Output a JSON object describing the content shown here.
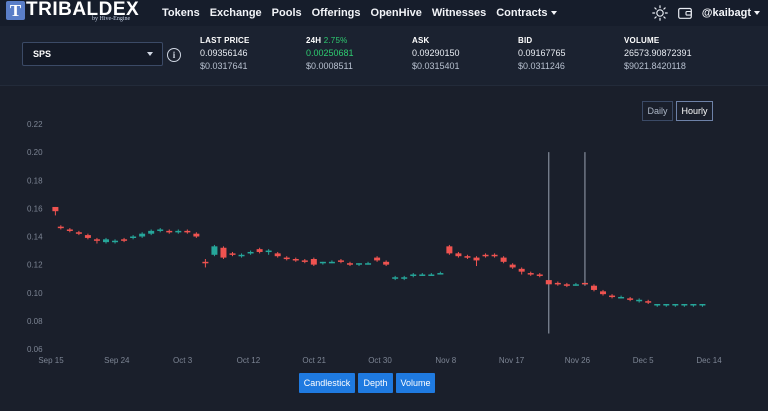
{
  "brand": {
    "name": "TRIBALDEX",
    "badge": "T",
    "sub": "by Hive-Engine"
  },
  "nav": {
    "items": [
      "Tokens",
      "Exchange",
      "Pools",
      "Offerings",
      "OpenHive",
      "Witnesses",
      "Contracts"
    ],
    "user": "@kaibagt"
  },
  "icons": {
    "theme": "sun-icon",
    "wallet": "wallet-icon",
    "info": "info-icon"
  },
  "token_select": {
    "value": "SPS"
  },
  "stats": {
    "last_price": {
      "label": "LAST PRICE",
      "value": "0.09356146",
      "usd": "$0.0317641"
    },
    "change_24h": {
      "label": "24H",
      "pct": "2.75%",
      "value": "0.00250681",
      "usd": "$0.0008511"
    },
    "ask": {
      "label": "ASK",
      "value": "0.09290150",
      "usd": "$0.0315401"
    },
    "bid": {
      "label": "BID",
      "value": "0.09167765",
      "usd": "$0.0311246"
    },
    "volume": {
      "label": "VOLUME",
      "value": "26573.90872391",
      "usd": "$9021.8420118"
    }
  },
  "interval": {
    "daily": "Daily",
    "hourly": "Hourly",
    "selected": "Hourly"
  },
  "chart_tabs": {
    "candlestick": "Candlestick",
    "depth": "Depth",
    "volume": "Volume"
  },
  "colors": {
    "up": "#26a69a",
    "down": "#ef5350",
    "wick": "#9aa3b2",
    "axis_text": "#7d8594",
    "button": "#1f7ae0"
  },
  "chart_data": {
    "type": "candlestick",
    "x_ticks": [
      "Sep 15",
      "Sep 24",
      "Oct 3",
      "Oct 12",
      "Oct 21",
      "Oct 30",
      "Nov 8",
      "Nov 17",
      "Nov 26",
      "Dec 5",
      "Dec 14"
    ],
    "y_ticks": [
      "0.22",
      "0.20",
      "0.18",
      "0.16",
      "0.14",
      "0.12",
      "0.10",
      "0.08",
      "0.06"
    ],
    "ylim": [
      0.06,
      0.22
    ],
    "series": [
      {
        "day": 1.0,
        "o": 0.161,
        "h": 0.161,
        "l": 0.155,
        "c": 0.158
      },
      {
        "day": 1.6,
        "o": 0.147,
        "h": 0.148,
        "l": 0.145,
        "c": 0.146
      },
      {
        "day": 2.6,
        "o": 0.145,
        "h": 0.146,
        "l": 0.143,
        "c": 0.144
      },
      {
        "day": 3.6,
        "o": 0.143,
        "h": 0.144,
        "l": 0.141,
        "c": 0.142
      },
      {
        "day": 4.6,
        "o": 0.141,
        "h": 0.142,
        "l": 0.138,
        "c": 0.139
      },
      {
        "day": 5.6,
        "o": 0.138,
        "h": 0.139,
        "l": 0.135,
        "c": 0.137
      },
      {
        "day": 6.6,
        "o": 0.136,
        "h": 0.139,
        "l": 0.135,
        "c": 0.138
      },
      {
        "day": 7.6,
        "o": 0.136,
        "h": 0.138,
        "l": 0.135,
        "c": 0.137
      },
      {
        "day": 8.6,
        "o": 0.138,
        "h": 0.139,
        "l": 0.136,
        "c": 0.137
      },
      {
        "day": 9.6,
        "o": 0.139,
        "h": 0.141,
        "l": 0.138,
        "c": 0.14
      },
      {
        "day": 10.6,
        "o": 0.14,
        "h": 0.143,
        "l": 0.139,
        "c": 0.142
      },
      {
        "day": 11.6,
        "o": 0.142,
        "h": 0.145,
        "l": 0.141,
        "c": 0.144
      },
      {
        "day": 12.6,
        "o": 0.144,
        "h": 0.146,
        "l": 0.143,
        "c": 0.145
      },
      {
        "day": 13.6,
        "o": 0.144,
        "h": 0.145,
        "l": 0.142,
        "c": 0.143
      },
      {
        "day": 14.6,
        "o": 0.143,
        "h": 0.145,
        "l": 0.142,
        "c": 0.144
      },
      {
        "day": 15.6,
        "o": 0.144,
        "h": 0.145,
        "l": 0.142,
        "c": 0.143
      },
      {
        "day": 16.6,
        "o": 0.142,
        "h": 0.143,
        "l": 0.139,
        "c": 0.14
      },
      {
        "day": 17.6,
        "o": 0.122,
        "h": 0.124,
        "l": 0.118,
        "c": 0.121
      },
      {
        "day": 18.6,
        "o": 0.127,
        "h": 0.134,
        "l": 0.126,
        "c": 0.133
      },
      {
        "day": 19.6,
        "o": 0.132,
        "h": 0.133,
        "l": 0.124,
        "c": 0.125
      },
      {
        "day": 20.6,
        "o": 0.128,
        "h": 0.129,
        "l": 0.126,
        "c": 0.127
      },
      {
        "day": 21.6,
        "o": 0.126,
        "h": 0.128,
        "l": 0.125,
        "c": 0.127
      },
      {
        "day": 22.6,
        "o": 0.128,
        "h": 0.13,
        "l": 0.127,
        "c": 0.129
      },
      {
        "day": 23.6,
        "o": 0.131,
        "h": 0.132,
        "l": 0.128,
        "c": 0.129
      },
      {
        "day": 24.6,
        "o": 0.129,
        "h": 0.131,
        "l": 0.127,
        "c": 0.13
      },
      {
        "day": 25.6,
        "o": 0.128,
        "h": 0.129,
        "l": 0.125,
        "c": 0.126
      },
      {
        "day": 26.6,
        "o": 0.125,
        "h": 0.126,
        "l": 0.123,
        "c": 0.124
      },
      {
        "day": 27.6,
        "o": 0.124,
        "h": 0.125,
        "l": 0.122,
        "c": 0.123
      },
      {
        "day": 28.6,
        "o": 0.123,
        "h": 0.124,
        "l": 0.121,
        "c": 0.122
      },
      {
        "day": 29.6,
        "o": 0.124,
        "h": 0.125,
        "l": 0.119,
        "c": 0.12
      },
      {
        "day": 30.6,
        "o": 0.121,
        "h": 0.122,
        "l": 0.12,
        "c": 0.122
      },
      {
        "day": 31.6,
        "o": 0.122,
        "h": 0.123,
        "l": 0.121,
        "c": 0.122
      },
      {
        "day": 32.6,
        "o": 0.123,
        "h": 0.124,
        "l": 0.121,
        "c": 0.122
      },
      {
        "day": 33.6,
        "o": 0.121,
        "h": 0.122,
        "l": 0.119,
        "c": 0.12
      },
      {
        "day": 34.6,
        "o": 0.12,
        "h": 0.121,
        "l": 0.119,
        "c": 0.121
      },
      {
        "day": 35.6,
        "o": 0.121,
        "h": 0.122,
        "l": 0.12,
        "c": 0.121
      },
      {
        "day": 36.6,
        "o": 0.125,
        "h": 0.126,
        "l": 0.122,
        "c": 0.123
      },
      {
        "day": 37.6,
        "o": 0.122,
        "h": 0.123,
        "l": 0.119,
        "c": 0.12
      },
      {
        "day": 38.6,
        "o": 0.11,
        "h": 0.112,
        "l": 0.109,
        "c": 0.111
      },
      {
        "day": 39.6,
        "o": 0.11,
        "h": 0.112,
        "l": 0.109,
        "c": 0.111
      },
      {
        "day": 40.6,
        "o": 0.112,
        "h": 0.114,
        "l": 0.111,
        "c": 0.113
      },
      {
        "day": 41.6,
        "o": 0.113,
        "h": 0.114,
        "l": 0.112,
        "c": 0.113
      },
      {
        "day": 42.6,
        "o": 0.113,
        "h": 0.114,
        "l": 0.112,
        "c": 0.113
      },
      {
        "day": 43.6,
        "o": 0.114,
        "h": 0.115,
        "l": 0.113,
        "c": 0.114
      },
      {
        "day": 44.6,
        "o": 0.133,
        "h": 0.134,
        "l": 0.127,
        "c": 0.128
      },
      {
        "day": 45.6,
        "o": 0.128,
        "h": 0.129,
        "l": 0.125,
        "c": 0.126
      },
      {
        "day": 46.6,
        "o": 0.126,
        "h": 0.127,
        "l": 0.124,
        "c": 0.125
      },
      {
        "day": 47.6,
        "o": 0.125,
        "h": 0.126,
        "l": 0.119,
        "c": 0.123
      },
      {
        "day": 48.6,
        "o": 0.127,
        "h": 0.128,
        "l": 0.125,
        "c": 0.126
      },
      {
        "day": 49.6,
        "o": 0.127,
        "h": 0.128,
        "l": 0.125,
        "c": 0.126
      },
      {
        "day": 50.6,
        "o": 0.125,
        "h": 0.126,
        "l": 0.121,
        "c": 0.122
      },
      {
        "day": 51.6,
        "o": 0.12,
        "h": 0.121,
        "l": 0.117,
        "c": 0.118
      },
      {
        "day": 52.6,
        "o": 0.117,
        "h": 0.118,
        "l": 0.113,
        "c": 0.115
      },
      {
        "day": 53.6,
        "o": 0.114,
        "h": 0.115,
        "l": 0.112,
        "c": 0.113
      },
      {
        "day": 54.6,
        "o": 0.113,
        "h": 0.114,
        "l": 0.111,
        "c": 0.112
      },
      {
        "day": 55.6,
        "o": 0.109,
        "h": 0.2,
        "l": 0.071,
        "c": 0.106
      },
      {
        "day": 56.6,
        "o": 0.107,
        "h": 0.108,
        "l": 0.105,
        "c": 0.106
      },
      {
        "day": 57.6,
        "o": 0.106,
        "h": 0.107,
        "l": 0.104,
        "c": 0.105
      },
      {
        "day": 58.6,
        "o": 0.106,
        "h": 0.107,
        "l": 0.105,
        "c": 0.106
      },
      {
        "day": 59.6,
        "o": 0.107,
        "h": 0.2,
        "l": 0.105,
        "c": 0.106
      },
      {
        "day": 60.6,
        "o": 0.105,
        "h": 0.106,
        "l": 0.101,
        "c": 0.102
      },
      {
        "day": 61.6,
        "o": 0.101,
        "h": 0.102,
        "l": 0.098,
        "c": 0.099
      },
      {
        "day": 62.6,
        "o": 0.098,
        "h": 0.099,
        "l": 0.096,
        "c": 0.097
      },
      {
        "day": 63.6,
        "o": 0.097,
        "h": 0.098,
        "l": 0.096,
        "c": 0.097
      },
      {
        "day": 64.6,
        "o": 0.096,
        "h": 0.097,
        "l": 0.094,
        "c": 0.095
      },
      {
        "day": 65.6,
        "o": 0.094,
        "h": 0.096,
        "l": 0.093,
        "c": 0.095
      },
      {
        "day": 66.6,
        "o": 0.094,
        "h": 0.095,
        "l": 0.092,
        "c": 0.093
      },
      {
        "day": 67.6,
        "o": 0.091,
        "h": 0.092,
        "l": 0.09,
        "c": 0.092
      },
      {
        "day": 68.6,
        "o": 0.091,
        "h": 0.092,
        "l": 0.09,
        "c": 0.092
      },
      {
        "day": 69.6,
        "o": 0.091,
        "h": 0.092,
        "l": 0.09,
        "c": 0.092
      },
      {
        "day": 70.6,
        "o": 0.091,
        "h": 0.092,
        "l": 0.09,
        "c": 0.092
      },
      {
        "day": 71.6,
        "o": 0.091,
        "h": 0.092,
        "l": 0.09,
        "c": 0.092
      },
      {
        "day": 72.6,
        "o": 0.091,
        "h": 0.092,
        "l": 0.09,
        "c": 0.092
      }
    ]
  }
}
